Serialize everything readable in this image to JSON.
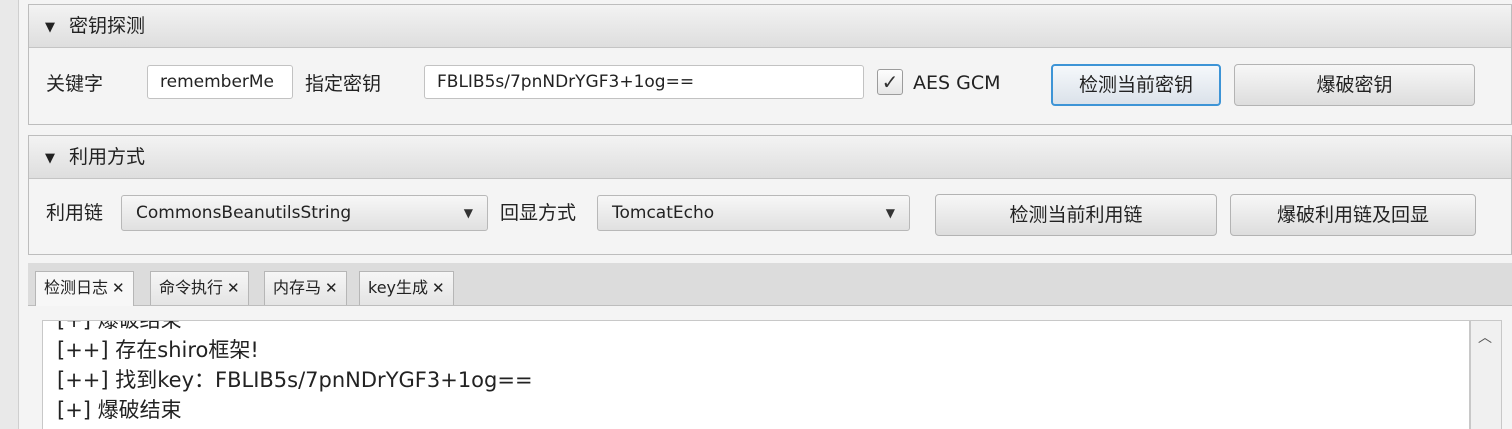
{
  "key_panel": {
    "title": "密钥探测",
    "keyword_label": "关键字",
    "keyword_value": "rememberMe",
    "key_label": "指定密钥",
    "key_value": "FBLIB5s/7pnNDrYGF3+1og==",
    "aes_gcm_label": "AES GCM",
    "aes_gcm_checked": true,
    "detect_button": "检测当前密钥",
    "brute_button": "爆破密钥"
  },
  "exploit_panel": {
    "title": "利用方式",
    "chain_label": "利用链",
    "chain_value": "CommonsBeanutilsString",
    "echo_label": "回显方式",
    "echo_value": "TomcatEcho",
    "detect_chain_button": "检测当前利用链",
    "brute_chain_button": "爆破利用链及回显"
  },
  "tabs": [
    {
      "label": "检测日志",
      "active": true
    },
    {
      "label": "命令执行",
      "active": false
    },
    {
      "label": "内存马",
      "active": false
    },
    {
      "label": "key生成",
      "active": false
    }
  ],
  "log_lines": [
    "[+] 爆破结束",
    "[++] 存在shiro框架!",
    "[++] 找到key：FBLIB5s/7pnNDrYGF3+1og==",
    "[+] 爆破结束"
  ],
  "icons": {
    "collapse": "triangle-down",
    "close": "close-x",
    "scroll_up": "chevron-up",
    "check": "checkmark"
  }
}
